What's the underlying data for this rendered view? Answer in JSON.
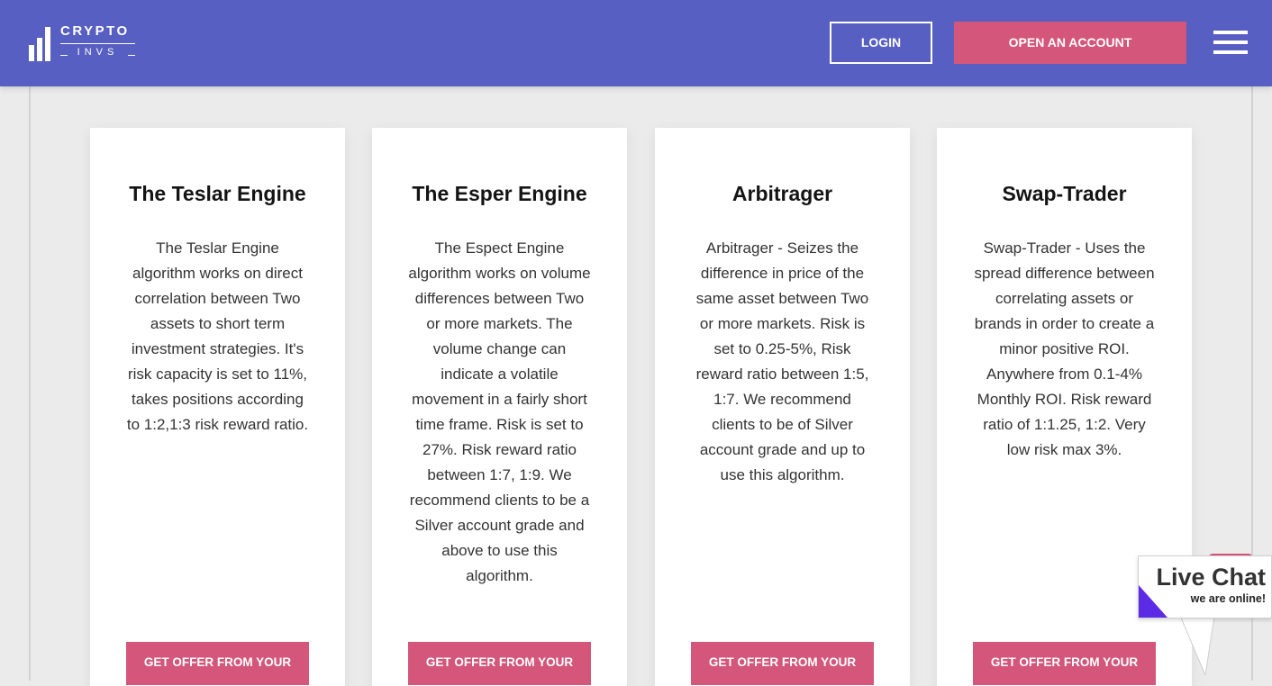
{
  "header": {
    "logo": {
      "top": "CRYPTO",
      "bottom": "INVS"
    },
    "login_label": "LOGIN",
    "open_account_label": "OPEN AN ACCOUNT",
    "menu_icon": "hamburger-menu-icon"
  },
  "cards": [
    {
      "title": "The Teslar Engine",
      "text": "The Teslar Engine algorithm works on direct correlation between Two assets to short term investment strategies. It's risk capacity is set to 11%, takes positions according to 1:2,1:3 risk reward ratio.",
      "button": "GET OFFER FROM YOUR"
    },
    {
      "title": "The Esper Engine",
      "text": "The Espect Engine algorithm works on volume differences between Two or more markets. The volume change can indicate a volatile movement in a fairly short time frame. Risk is set to 27%. Risk reward ratio between 1:7, 1:9. We recommend clients to be a Silver account grade and above to use this algorithm.",
      "button": "GET OFFER FROM YOUR"
    },
    {
      "title": "Arbitrager",
      "text": "Arbitrager - Seizes the difference in price of the same asset between Two or more markets. Risk is set to 0.25-5%, Risk reward ratio between 1:5, 1:7. We recommend clients to be of Silver account grade and up to use this algorithm.",
      "button": "GET OFFER FROM YOUR"
    },
    {
      "title": "Swap-Trader",
      "text": "Swap-Trader - Uses the spread difference between correlating assets or brands in order to create a minor positive ROI. Anywhere from 0.1-4% Monthly ROI. Risk reward ratio of 1:1.25, 1:2. Very low risk max 3%.",
      "button": "GET OFFER FROM YOUR"
    }
  ],
  "live_chat": {
    "title": "Live Chat",
    "subtitle": "we are online!"
  },
  "colors": {
    "header_bg": "#575fc2",
    "accent_pink": "#d4567a",
    "chat_triangle": "#5b2be6"
  }
}
